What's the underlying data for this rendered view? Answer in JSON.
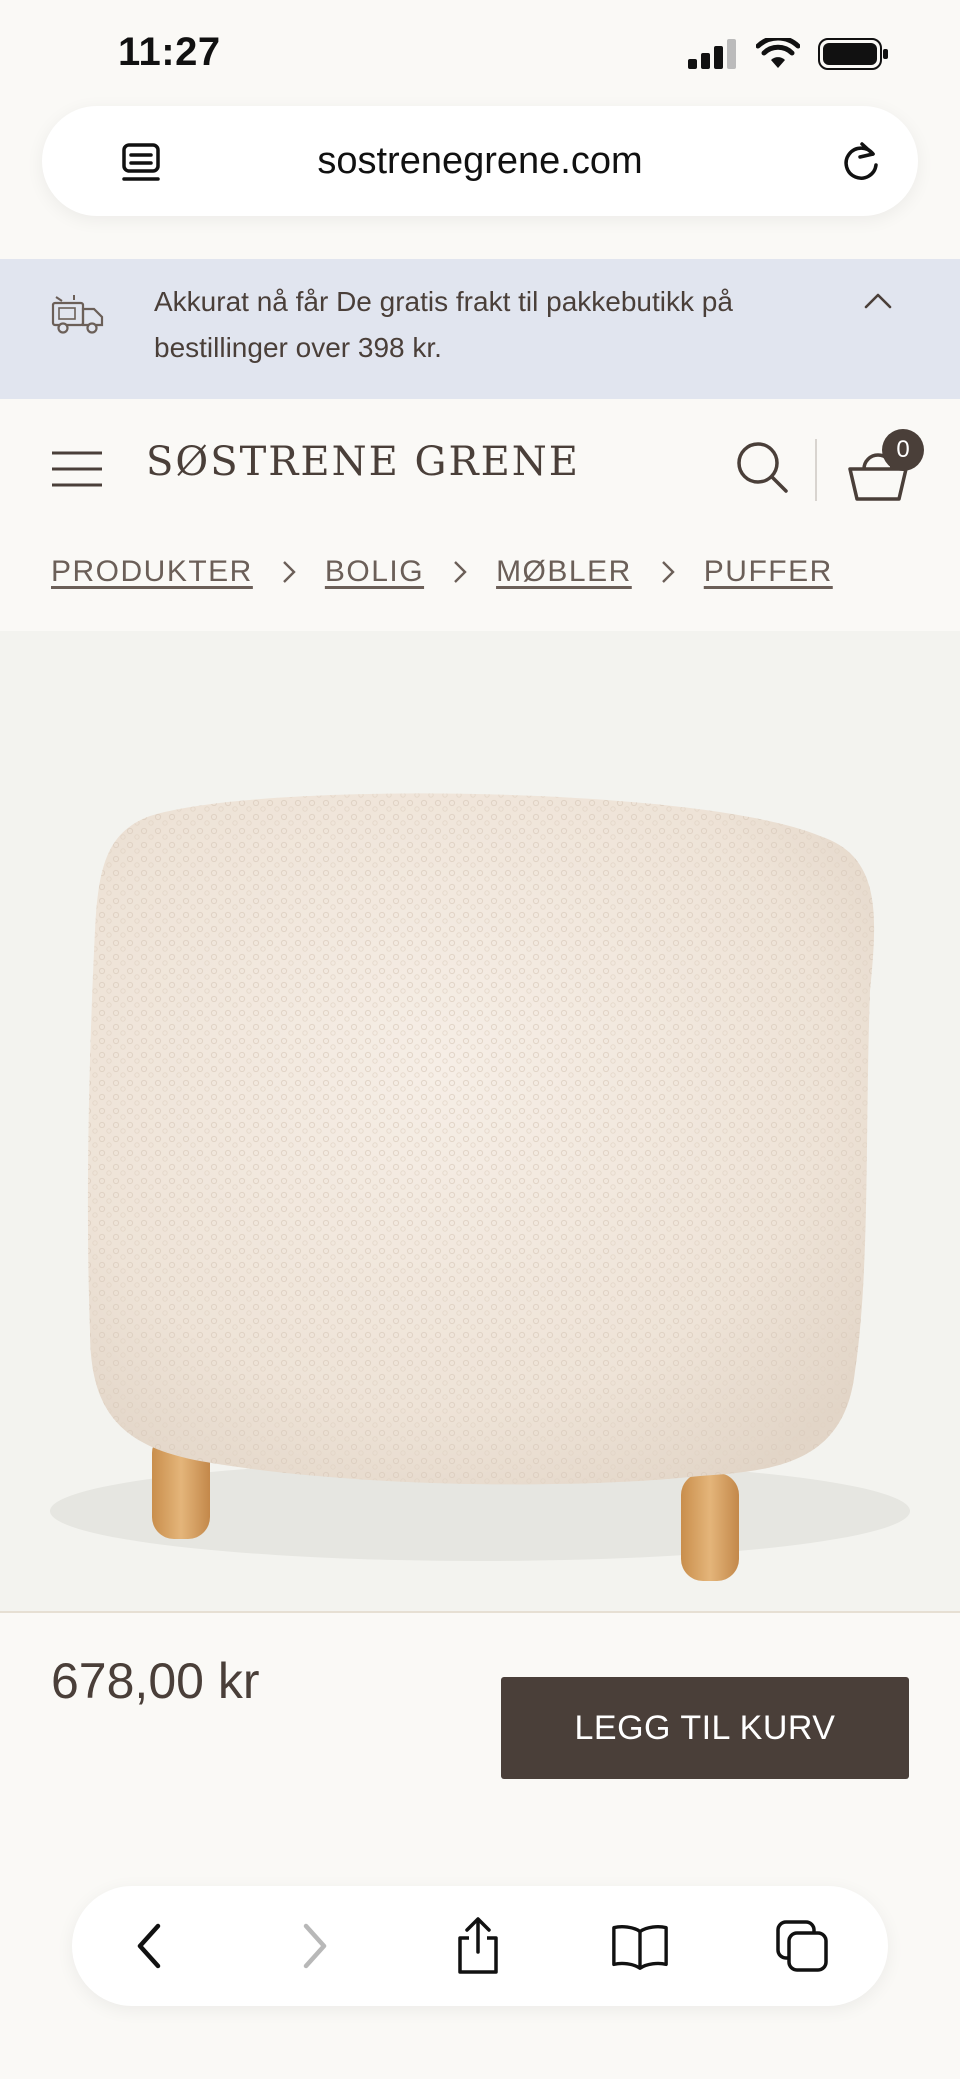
{
  "status_bar": {
    "time": "11:27"
  },
  "browser": {
    "url": "sostrenegrene.com"
  },
  "promo": {
    "line1": "Akkurat nå får De gratis frakt til pakkebutikk på",
    "line2": "bestillinger over 398 kr."
  },
  "header": {
    "logo": "SØSTRENE GRENE",
    "cart_count": "0"
  },
  "breadcrumb": [
    "PRODUKTER",
    "BOLIG",
    "MØBLER",
    "PUFFER"
  ],
  "product": {
    "price": "678,00 kr",
    "add_to_cart_label": "LEGG TIL KURV"
  },
  "colors": {
    "brand_brown": "#4a3f39",
    "promo_bg": "#e1e5ef",
    "page_bg": "#faf9f6"
  },
  "icons": [
    "tabs-icon",
    "reload-icon",
    "delivery-truck-icon",
    "chevron-up-icon",
    "menu-icon",
    "search-icon",
    "basket-icon",
    "back-icon",
    "forward-icon",
    "share-icon",
    "bookmarks-icon",
    "tabs-overview-icon"
  ]
}
